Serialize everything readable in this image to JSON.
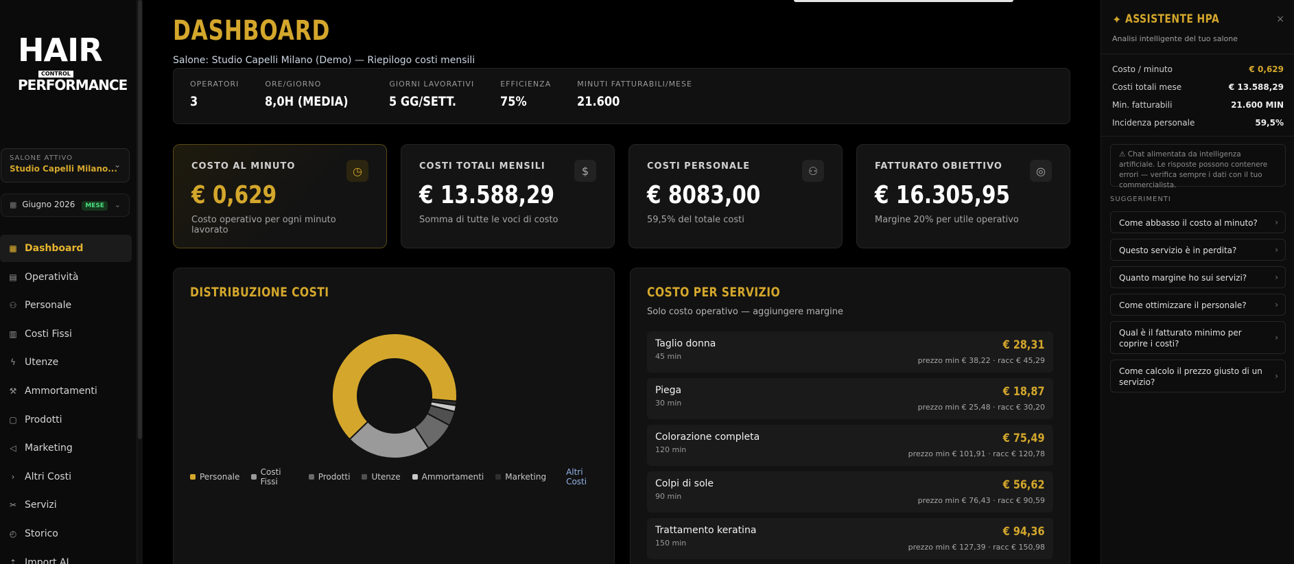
{
  "brand": {
    "line1": "HAIR",
    "line_small": "CONTROL",
    "line2": "PERFORMANCE"
  },
  "salon": {
    "label": "SALONE ATTIVO",
    "value": "Studio Capelli Milano..."
  },
  "period": {
    "month": "Giugno 2026",
    "badge": "MESE"
  },
  "nav": [
    {
      "label": "Dashboard",
      "icon": "grid-icon",
      "active": true
    },
    {
      "label": "Operatività",
      "icon": "calendar-icon"
    },
    {
      "label": "Personale",
      "icon": "users-icon"
    },
    {
      "label": "Costi Fissi",
      "icon": "building-icon"
    },
    {
      "label": "Utenze",
      "icon": "bolt-icon"
    },
    {
      "label": "Ammortamenti",
      "icon": "wrench-icon"
    },
    {
      "label": "Prodotti",
      "icon": "bag-icon"
    },
    {
      "label": "Marketing",
      "icon": "megaphone-icon"
    },
    {
      "label": "Altri Costi",
      "icon": "chevron-right-icon"
    },
    {
      "label": "Servizi",
      "icon": "scissors-icon"
    },
    {
      "label": "Storico",
      "icon": "history-icon"
    },
    {
      "label": "Import AI",
      "icon": "upload-icon"
    }
  ],
  "header": {
    "title": "DASHBOARD",
    "subtitle": "Salone: Studio Capelli Milano (Demo) — Riepilogo costi mensili"
  },
  "info": [
    {
      "k": "OPERATORI",
      "v": "3"
    },
    {
      "k": "ORE/GIORNO",
      "v": "8,0H (MEDIA)"
    },
    {
      "k": "GIORNI LAVORATIVI",
      "v": "5 GG/SETT."
    },
    {
      "k": "EFFICIENZA",
      "v": "75%"
    },
    {
      "k": "MINUTI FATTURABILI/MESE",
      "v": "21.600"
    }
  ],
  "kpis": [
    {
      "label": "COSTO AL MINUTO",
      "value": "€ 0,629",
      "desc": "Costo operativo per ogni minuto lavorato",
      "icon": "clock-icon",
      "glyph": "◷"
    },
    {
      "label": "COSTI TOTALI MENSILI",
      "value": "€ 13.588,29",
      "desc": "Somma di tutte le voci di costo",
      "icon": "dollar-icon",
      "glyph": "$"
    },
    {
      "label": "COSTI PERSONALE",
      "value": "€ 8083,00",
      "desc": "59,5% del totale costi",
      "icon": "users-icon",
      "glyph": "⚇"
    },
    {
      "label": "FATTURATO OBIETTIVO",
      "value": "€ 16.305,95",
      "desc": "Margine 20% per utile operativo",
      "icon": "target-icon",
      "glyph": "◎"
    }
  ],
  "distribution": {
    "title": "DISTRIBUZIONE COSTI",
    "legend_extra": "Altri Costi"
  },
  "chart_data": {
    "type": "pie",
    "categories": [
      "Personale",
      "Costi Fissi",
      "Prodotti",
      "Utenze",
      "Ammortamenti",
      "Marketing"
    ],
    "values": [
      59.5,
      20.5,
      7.5,
      3.5,
      1.5,
      1.0
    ],
    "colors": [
      "#d4a72c",
      "#9a9a9a",
      "#6a6a6a",
      "#505050",
      "#c8c8c8",
      "#2e2e2e"
    ],
    "extra_legend": "Altri Costi",
    "donut": true
  },
  "services": {
    "title": "COSTO PER SERVIZIO",
    "subtitle": "Solo costo operativo — aggiungere margine",
    "items": [
      {
        "name": "Taglio donna",
        "dur": "45 min",
        "cost": "€ 28,31",
        "price": "prezzo min € 38,22 · racc € 45,29"
      },
      {
        "name": "Piega",
        "dur": "30 min",
        "cost": "€ 18,87",
        "price": "prezzo min € 25,48 · racc € 30,20"
      },
      {
        "name": "Colorazione completa",
        "dur": "120 min",
        "cost": "€ 75,49",
        "price": "prezzo min € 101,91 · racc € 120,78"
      },
      {
        "name": "Colpi di sole",
        "dur": "90 min",
        "cost": "€ 56,62",
        "price": "prezzo min € 76,43 · racc € 90,59"
      },
      {
        "name": "Trattamento keratina",
        "dur": "150 min",
        "cost": "€ 94,36",
        "price": "prezzo min € 127,39 · racc € 150,98"
      }
    ]
  },
  "assistant": {
    "title": "ASSISTENTE HPA",
    "subtitle": "Analisi intelligente del tuo salone",
    "close": "×",
    "metrics": [
      {
        "k": "Costo / minuto",
        "v": "€ 0,629",
        "gold": true
      },
      {
        "k": "Costi totali mese",
        "v": "€ 13.588,29"
      },
      {
        "k": "Min. fatturabili",
        "v": "21.600 MIN"
      },
      {
        "k": "Incidenza personale",
        "v": "59,5%"
      }
    ],
    "warning": "⚠ Chat alimentata da intelligenza artificiale. Le risposte possono contenere errori — verifica sempre i dati con il tuo commercialista.",
    "suggestions_label": "SUGGERIMENTI",
    "suggestions": [
      "Come abbasso il costo al minuto?",
      "Questo servizio è in perdita?",
      "Quanto margine ho sui servizi?",
      "Come ottimizzare il personale?",
      "Qual è il fatturato minimo per coprire i costi?",
      "Come calcolo il prezzo giusto di un servizio?"
    ]
  }
}
